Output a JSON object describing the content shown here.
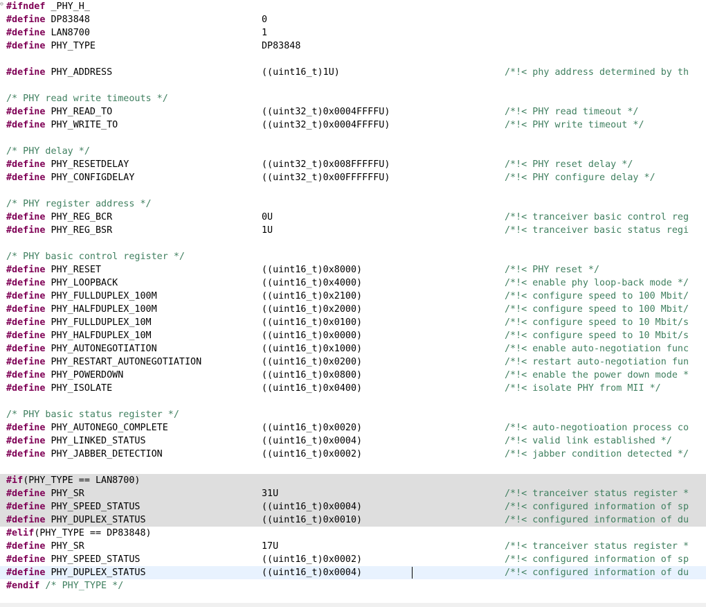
{
  "editor": {
    "language": "C",
    "lines": [
      {
        "fold": true,
        "kw": "#ifndef",
        "name": " _PHY_H_"
      },
      {
        "kw": "#define",
        "name": " DP83848",
        "value": "0"
      },
      {
        "kw": "#define",
        "name": " LAN8700",
        "value": "1"
      },
      {
        "kw": "#define",
        "name": " PHY_TYPE",
        "value": "DP83848"
      },
      {},
      {
        "kw": "#define",
        "name": " PHY_ADDRESS",
        "value": "((uint16_t)1U)",
        "comment": "/*!< phy address determined by th"
      },
      {},
      {
        "comment_line": "/* PHY read write timeouts */"
      },
      {
        "kw": "#define",
        "name": " PHY_READ_TO",
        "value": "((uint32_t)0x0004FFFFU)",
        "comment": "/*!< PHY read timeout */"
      },
      {
        "kw": "#define",
        "name": " PHY_WRITE_TO",
        "value": "((uint32_t)0x0004FFFFU)",
        "comment": "/*!< PHY write timeout */"
      },
      {},
      {
        "comment_line": "/* PHY delay */"
      },
      {
        "kw": "#define",
        "name": " PHY_RESETDELAY",
        "value": "((uint32_t)0x008FFFFFU)",
        "comment": "/*!< PHY reset delay */"
      },
      {
        "kw": "#define",
        "name": " PHY_CONFIGDELAY",
        "value": "((uint32_t)0x00FFFFFFU)",
        "comment": "/*!< PHY configure delay */"
      },
      {},
      {
        "comment_line": "/* PHY register address */"
      },
      {
        "kw": "#define",
        "name": " PHY_REG_BCR",
        "value": "0U",
        "comment": "/*!< tranceiver basic control reg"
      },
      {
        "kw": "#define",
        "name": " PHY_REG_BSR",
        "value": "1U",
        "comment": "/*!< tranceiver basic status regi"
      },
      {},
      {
        "comment_line": "/* PHY basic control register */"
      },
      {
        "kw": "#define",
        "name": " PHY_RESET",
        "value": "((uint16_t)0x8000)",
        "comment": "/*!< PHY reset */"
      },
      {
        "kw": "#define",
        "name": " PHY_LOOPBACK",
        "value": "((uint16_t)0x4000)",
        "comment": "/*!< enable phy loop-back mode */"
      },
      {
        "kw": "#define",
        "name": " PHY_FULLDUPLEX_100M",
        "value": "((uint16_t)0x2100)",
        "comment": "/*!< configure speed to 100 Mbit/"
      },
      {
        "kw": "#define",
        "name": " PHY_HALFDUPLEX_100M",
        "value": "((uint16_t)0x2000)",
        "comment": "/*!< configure speed to 100 Mbit/"
      },
      {
        "kw": "#define",
        "name": " PHY_FULLDUPLEX_10M",
        "value": "((uint16_t)0x0100)",
        "comment": "/*!< configure speed to 10 Mbit/s"
      },
      {
        "kw": "#define",
        "name": " PHY_HALFDUPLEX_10M",
        "value": "((uint16_t)0x0000)",
        "comment": "/*!< configure speed to 10 Mbit/s"
      },
      {
        "kw": "#define",
        "name": " PHY_AUTONEGOTIATION",
        "value": "((uint16_t)0x1000)",
        "comment": "/*!< enable auto-negotiation func"
      },
      {
        "kw": "#define",
        "name": " PHY_RESTART_AUTONEGOTIATION",
        "value": "((uint16_t)0x0200)",
        "comment": "/*!< restart auto-negotiation fun"
      },
      {
        "kw": "#define",
        "name": " PHY_POWERDOWN",
        "value": "((uint16_t)0x0800)",
        "comment": "/*!< enable the power down mode *"
      },
      {
        "kw": "#define",
        "name": " PHY_ISOLATE",
        "value": "((uint16_t)0x0400)",
        "comment": "/*!< isolate PHY from MII */"
      },
      {},
      {
        "comment_line": "/* PHY basic status register */"
      },
      {
        "kw": "#define",
        "name": " PHY_AUTONEGO_COMPLETE",
        "value": "((uint16_t)0x0020)",
        "comment": "/*!< auto-negotioation process co"
      },
      {
        "kw": "#define",
        "name": " PHY_LINKED_STATUS",
        "value": "((uint16_t)0x0004)",
        "comment": "/*!< valid link established */"
      },
      {
        "kw": "#define",
        "name": " PHY_JABBER_DETECTION",
        "value": "((uint16_t)0x0002)",
        "comment": "/*!< jabber condition detected */"
      },
      {},
      {
        "dim": true,
        "kw": "#if",
        "name": "(PHY_TYPE == LAN8700)"
      },
      {
        "dim": true,
        "kw": "#define",
        "name": " PHY_SR",
        "value": "31U",
        "comment": "/*!< tranceiver status register *"
      },
      {
        "dim": true,
        "kw": "#define",
        "name": " PHY_SPEED_STATUS",
        "value": "((uint16_t)0x0004)",
        "comment": "/*!< configured information of sp"
      },
      {
        "dim": true,
        "kw": "#define",
        "name": " PHY_DUPLEX_STATUS",
        "value": "((uint16_t)0x0010)",
        "comment": "/*!< configured information of du"
      },
      {
        "kw": "#elif",
        "name": "(PHY_TYPE == DP83848)"
      },
      {
        "kw": "#define",
        "name": " PHY_SR",
        "value": "17U",
        "comment": "/*!< tranceiver status register *"
      },
      {
        "kw": "#define",
        "name": " PHY_SPEED_STATUS",
        "value": "((uint16_t)0x0002)",
        "comment": "/*!< configured information of sp"
      },
      {
        "cur": true,
        "kw": "#define",
        "name": " PHY_DUPLEX_STATUS",
        "value": "((uint16_t)0x0004)",
        "comment": "/*!< configured information of du"
      },
      {
        "kw": "#endif",
        "trail": " /* PHY_TYPE */"
      }
    ]
  },
  "colors": {
    "keyword": "#7f0055",
    "comment": "#3f7f5f",
    "inactive_block": "#dedede",
    "current_line": "#e8f2fe"
  }
}
